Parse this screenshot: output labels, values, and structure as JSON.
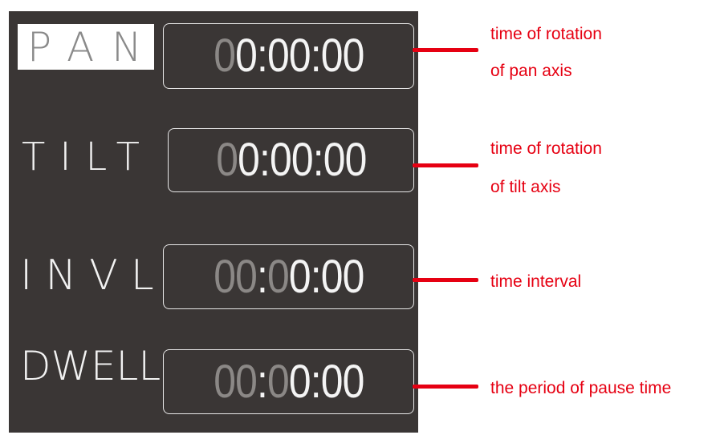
{
  "rows": [
    {
      "label": "PAN",
      "selected": true,
      "time": {
        "dim": "0",
        "bright": "0:00:00"
      },
      "notes": [
        "time of rotation",
        "of pan axis"
      ]
    },
    {
      "label": "TILT",
      "selected": false,
      "time": {
        "dim": "0",
        "bright": "0:00:00"
      },
      "notes": [
        "time of rotation",
        "of tilt axis"
      ]
    },
    {
      "label": "INVL",
      "selected": false,
      "time": {
        "dim_a": "00",
        "sep": ":",
        "dim_b": "0",
        "bright": "0:00"
      },
      "notes": [
        "time interval"
      ]
    },
    {
      "label": "DWELL",
      "selected": false,
      "time": {
        "dim_a": "00",
        "sep": ":",
        "dim_b": "0",
        "bright": "0:00"
      },
      "notes": [
        "the period of pause time"
      ]
    }
  ],
  "colors": {
    "screen_bg": "#3a3635",
    "text_bright": "#f4f4f4",
    "text_dim": "#8b8886",
    "annotation_red": "#e60012"
  }
}
